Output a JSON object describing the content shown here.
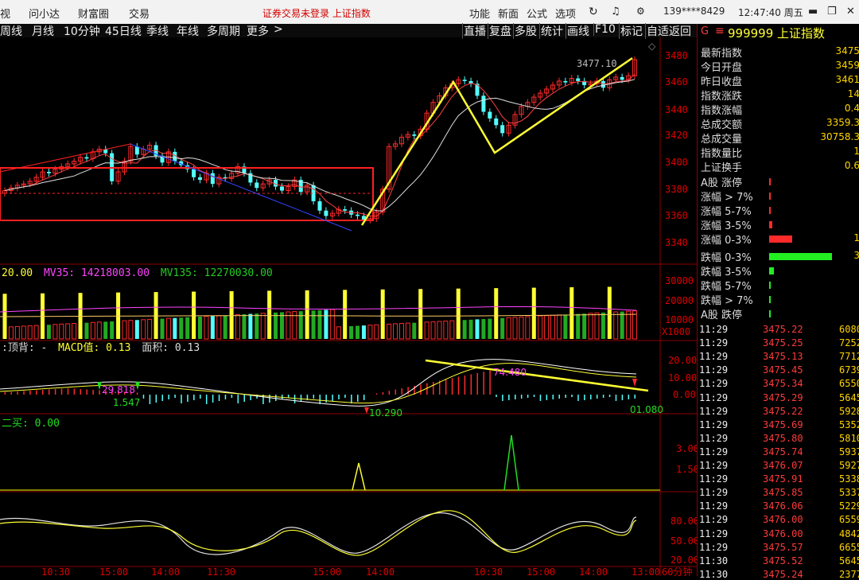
{
  "menubar": {
    "items_left": [
      "视",
      "问小达",
      "财富圈",
      "交易"
    ],
    "notice": "证券交易未登录  上证指数",
    "items_right": [
      "功能",
      "新面",
      "公式",
      "选项"
    ],
    "account": "139****8429",
    "clock": "12:47:40 周五"
  },
  "toolbar": {
    "periods": [
      "周线",
      "月线",
      "10分钟",
      "45日线",
      "季线",
      "年线",
      "多周期",
      "更多"
    ],
    "buttons": [
      "直播",
      "复盘",
      "多股",
      "统计",
      "画线",
      "F10",
      "标记",
      "自适返回"
    ]
  },
  "price_chart": {
    "y_ticks": [
      "3480",
      "3460",
      "3440",
      "3420",
      "3400",
      "3380",
      "3360",
      "3340"
    ],
    "high_label": "3477.10"
  },
  "volume_panel": {
    "legend": {
      "mv_prefix": "20.00",
      "mv35_label": "MV35: 14218003.00",
      "mv135_label": "MV135: 12270030.00"
    },
    "y_ticks": [
      "30000",
      "20000",
      "10000"
    ],
    "unit": "X1000"
  },
  "macd_panel": {
    "legend": {
      "a": ":顶背: -",
      "b": "MACD值: 0.13",
      "c": "面积: 0.13"
    },
    "y_ticks": [
      "20.00",
      "10.00",
      "0.00"
    ],
    "annot": {
      "a": "29.818",
      "b": "1.547",
      "c": "10.290",
      "d": "74.480",
      "e": "01.080"
    }
  },
  "signal_panel": {
    "legend": "二买: 0.00",
    "y_ticks": [
      "3.00",
      "1.50"
    ]
  },
  "kdj_panel": {
    "y_ticks": [
      "80.00",
      "50.00",
      "20.00"
    ]
  },
  "x_axis": {
    "ticks": [
      "10:30",
      "15:00",
      "14:00",
      "11:30",
      "15:00",
      "14:00",
      "10:30",
      "15:00",
      "14:00",
      "13:00"
    ],
    "tail": "60分钟"
  },
  "side": {
    "code": "G",
    "symbol": "999999 上证指数",
    "quote_rows": [
      {
        "label": "最新指数",
        "value": "3475"
      },
      {
        "label": "今日开盘",
        "value": "3459"
      },
      {
        "label": "昨日收盘",
        "value": "3461"
      },
      {
        "label": "指数涨跌",
        "value": "14"
      },
      {
        "label": "指数涨幅",
        "value": "0.4"
      },
      {
        "label": "总成交额",
        "value": "3359.3"
      },
      {
        "label": "总成交量",
        "value": "30758.3"
      },
      {
        "label": "指数量比",
        "value": "1"
      },
      {
        "label": "上证换手",
        "value": "0.6"
      }
    ],
    "dist_rows": [
      {
        "label": "A股 涨停",
        "bar": 0.01,
        "color": "#ff2a2a",
        "value": ""
      },
      {
        "label": "涨幅 > 7%",
        "bar": 0.01,
        "color": "#ff2a2a",
        "value": ""
      },
      {
        "label": "涨幅 5-7%",
        "bar": 0.01,
        "color": "#ff2a2a",
        "value": ""
      },
      {
        "label": "涨幅 3-5%",
        "bar": 0.04,
        "color": "#ff2a2a",
        "value": ""
      },
      {
        "label": "涨幅 0-3%",
        "bar": 0.26,
        "color": "#ff2a2a",
        "value": "1"
      },
      {
        "label": "跌幅 0-3%",
        "bar": 0.72,
        "color": "#22ee22",
        "value": "3"
      },
      {
        "label": "跌幅 3-5%",
        "bar": 0.05,
        "color": "#22ee22",
        "value": ""
      },
      {
        "label": "跌幅 5-7%",
        "bar": 0.01,
        "color": "#22ee22",
        "value": ""
      },
      {
        "label": "跌幅 > 7%",
        "bar": 0.01,
        "color": "#22ee22",
        "value": ""
      },
      {
        "label": "A股 跌停",
        "bar": 0.01,
        "color": "#22ee22",
        "value": ""
      }
    ],
    "ticks": [
      {
        "time": "11:29",
        "price": "3475.22",
        "vol": "6080"
      },
      {
        "time": "11:29",
        "price": "3475.25",
        "vol": "7252"
      },
      {
        "time": "11:29",
        "price": "3475.13",
        "vol": "7712"
      },
      {
        "time": "11:29",
        "price": "3475.45",
        "vol": "6739"
      },
      {
        "time": "11:29",
        "price": "3475.34",
        "vol": "6550"
      },
      {
        "time": "11:29",
        "price": "3475.29",
        "vol": "5645"
      },
      {
        "time": "11:29",
        "price": "3475.22",
        "vol": "5928"
      },
      {
        "time": "11:29",
        "price": "3475.69",
        "vol": "5352"
      },
      {
        "time": "11:29",
        "price": "3475.80",
        "vol": "5810"
      },
      {
        "time": "11:29",
        "price": "3475.74",
        "vol": "5937"
      },
      {
        "time": "11:29",
        "price": "3476.07",
        "vol": "5927"
      },
      {
        "time": "11:29",
        "price": "3475.91",
        "vol": "5338"
      },
      {
        "time": "11:29",
        "price": "3475.85",
        "vol": "5337"
      },
      {
        "time": "11:29",
        "price": "3476.06",
        "vol": "5229"
      },
      {
        "time": "11:29",
        "price": "3476.00",
        "vol": "6559"
      },
      {
        "time": "11:29",
        "price": "3476.00",
        "vol": "4842"
      },
      {
        "time": "11:29",
        "price": "3475.57",
        "vol": "6655"
      },
      {
        "time": "11:30",
        "price": "3475.52",
        "vol": "5645"
      },
      {
        "time": "11:30",
        "price": "3475.24",
        "vol": "2377"
      }
    ]
  },
  "colors": {
    "up": "#ff2a2a",
    "down": "#54ffff",
    "grid": "#8b0000",
    "yellow": "#ffff33",
    "ma": "#ffffff"
  }
}
